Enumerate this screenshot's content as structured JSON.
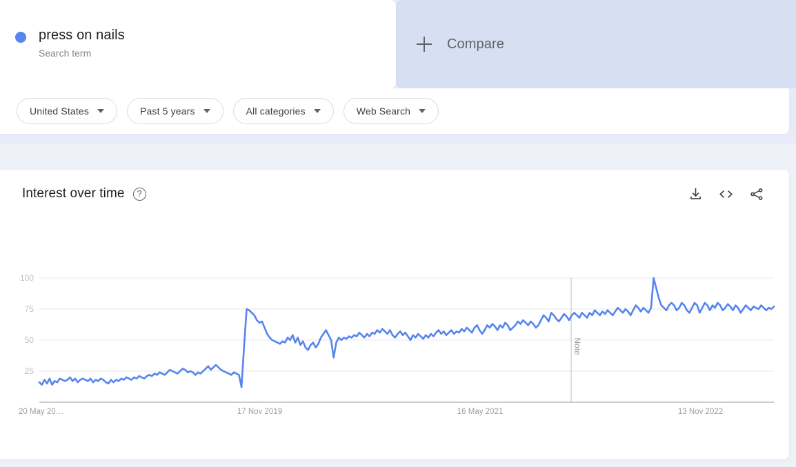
{
  "search_term": {
    "title": "press on nails",
    "subtitle": "Search term",
    "dot_color": "#5585ed"
  },
  "compare": {
    "label": "Compare",
    "plus_icon": "plus-icon"
  },
  "filters": [
    {
      "label": "United States",
      "icon": "chevron-down-icon"
    },
    {
      "label": "Past 5 years",
      "icon": "chevron-down-icon"
    },
    {
      "label": "All categories",
      "icon": "chevron-down-icon"
    },
    {
      "label": "Web Search",
      "icon": "chevron-down-icon"
    }
  ],
  "chart_panel": {
    "title": "Interest over time",
    "help_icon": "help-circle-icon",
    "help_glyph": "?",
    "actions": [
      {
        "name": "download-icon",
        "tooltip": "Download"
      },
      {
        "name": "embed-code-icon",
        "tooltip": "Embed"
      },
      {
        "name": "share-icon",
        "tooltip": "Share"
      }
    ]
  },
  "chart_data": {
    "type": "line",
    "title": "Interest over time",
    "xlabel": "",
    "ylabel": "",
    "ylim": [
      0,
      100
    ],
    "grid": true,
    "legend_position": "none",
    "line_color": "#5585ed",
    "y_ticks": [
      100,
      75,
      50,
      25
    ],
    "x_ticks": [
      {
        "label": "20 May 20…",
        "x_frac": 0.0
      },
      {
        "label": "17 Nov 2019",
        "x_frac": 0.3
      },
      {
        "label": "16 May 2021",
        "x_frac": 0.6
      },
      {
        "label": "13 Nov 2022",
        "x_frac": 0.9
      }
    ],
    "annotations": [
      {
        "label": "Note",
        "x_frac": 0.724,
        "orientation": "vertical",
        "line": true
      }
    ],
    "series": [
      {
        "name": "press on nails",
        "color": "#5585ed",
        "values": [
          16,
          14,
          18,
          15,
          19,
          14,
          17,
          16,
          19,
          18,
          17,
          18,
          20,
          17,
          19,
          16,
          18,
          19,
          18,
          17,
          19,
          16,
          18,
          17,
          19,
          18,
          16,
          15,
          18,
          16,
          18,
          17,
          19,
          18,
          20,
          19,
          18,
          20,
          19,
          21,
          20,
          19,
          21,
          22,
          21,
          23,
          22,
          24,
          23,
          22,
          24,
          26,
          25,
          24,
          23,
          25,
          27,
          26,
          24,
          25,
          24,
          22,
          24,
          23,
          25,
          27,
          29,
          26,
          28,
          30,
          28,
          26,
          25,
          24,
          23,
          22,
          24,
          23,
          22,
          12,
          45,
          75,
          74,
          72,
          70,
          66,
          64,
          65,
          60,
          55,
          52,
          50,
          49,
          48,
          47,
          49,
          48,
          52,
          50,
          54,
          48,
          52,
          46,
          49,
          44,
          42,
          46,
          48,
          44,
          47,
          52,
          55,
          58,
          54,
          50,
          36,
          48,
          52,
          50,
          52,
          51,
          53,
          52,
          54,
          53,
          56,
          54,
          52,
          55,
          53,
          56,
          55,
          58,
          56,
          59,
          57,
          55,
          58,
          54,
          52,
          55,
          57,
          54,
          56,
          53,
          50,
          54,
          52,
          55,
          53,
          51,
          54,
          52,
          55,
          53,
          56,
          58,
          55,
          57,
          54,
          56,
          58,
          55,
          57,
          56,
          59,
          57,
          60,
          58,
          56,
          60,
          62,
          58,
          55,
          58,
          62,
          60,
          63,
          61,
          58,
          62,
          60,
          64,
          62,
          58,
          60,
          62,
          65,
          63,
          66,
          64,
          62,
          65,
          63,
          60,
          62,
          66,
          70,
          68,
          65,
          72,
          70,
          67,
          65,
          68,
          71,
          69,
          66,
          70,
          72,
          70,
          68,
          72,
          70,
          68,
          72,
          70,
          74,
          72,
          70,
          73,
          71,
          74,
          72,
          70,
          73,
          76,
          74,
          72,
          75,
          73,
          70,
          74,
          78,
          76,
          73,
          76,
          74,
          72,
          76,
          100,
          92,
          84,
          78,
          76,
          74,
          78,
          80,
          78,
          74,
          76,
          80,
          78,
          74,
          72,
          76,
          80,
          78,
          72,
          76,
          80,
          78,
          74,
          78,
          76,
          80,
          78,
          74,
          76,
          79,
          77,
          74,
          78,
          76,
          72,
          75,
          78,
          76,
          74,
          77,
          76,
          75,
          78,
          76,
          74,
          76,
          75,
          77
        ]
      }
    ]
  }
}
